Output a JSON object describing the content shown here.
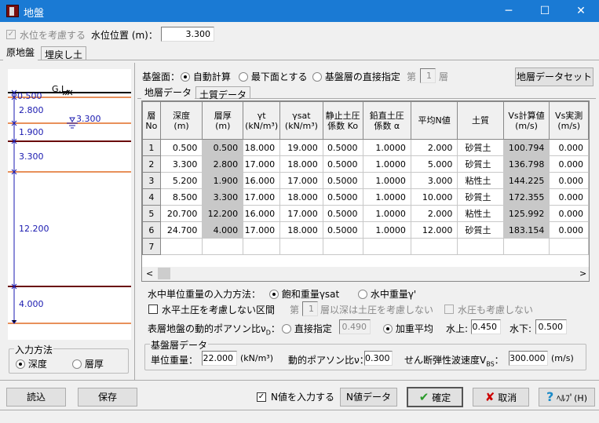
{
  "window": {
    "title": "地盤",
    "minimize": "─",
    "maximize": "☐",
    "close": "✕"
  },
  "water": {
    "consider_label": "水位を考慮する",
    "consider_checked": true,
    "level_label": "水位位置 (m)：",
    "level_value": "3.300"
  },
  "tabs": [
    "原地盤",
    "埋戻し土"
  ],
  "diagram": {
    "gl_label": "G.L.",
    "water_label": "3.300",
    "thickness_labels": [
      "0.500",
      "2.800",
      "1.900",
      "3.300",
      "12.200",
      "4.000"
    ],
    "colors": {
      "sand": "#e8905a",
      "clay": "#6a0c0c",
      "gl": "#000000",
      "dim": "#1a1ab0"
    }
  },
  "input_method": {
    "legend": "入力方法",
    "options": [
      "深度",
      "層厚"
    ],
    "selected": 0
  },
  "base": {
    "label": "基盤面：",
    "options": [
      "自動計算",
      "最下面とする",
      "基盤層の直接指定"
    ],
    "selected": 0,
    "layer_prefix": "第",
    "layer_value": "1",
    "layer_suffix": "層",
    "set_button": "地層データセット"
  },
  "inner_tabs": [
    "地層データ",
    "土質データ"
  ],
  "table": {
    "headers": [
      [
        "層",
        "No"
      ],
      [
        "深度",
        "(m)"
      ],
      [
        "層厚",
        "(m)"
      ],
      [
        "γt",
        "(kN/m³)"
      ],
      [
        "γsat",
        "(kN/m³)"
      ],
      [
        "静止土圧",
        "係数 Ko"
      ],
      [
        "鉛直土圧",
        "係数 α"
      ],
      [
        "平均N値",
        ""
      ],
      [
        "土質",
        ""
      ],
      [
        "Vs計算値",
        "(m/s)"
      ],
      [
        "Vs実測",
        "(m/s)"
      ]
    ],
    "rows": [
      [
        "1",
        "0.500",
        "0.500",
        "18.000",
        "19.000",
        "0.5000",
        "1.0000",
        "2.000",
        "砂質土",
        "100.794",
        "0.000"
      ],
      [
        "2",
        "3.300",
        "2.800",
        "17.000",
        "18.000",
        "0.5000",
        "1.0000",
        "5.000",
        "砂質土",
        "136.798",
        "0.000"
      ],
      [
        "3",
        "5.200",
        "1.900",
        "16.000",
        "17.000",
        "0.5000",
        "1.0000",
        "3.000",
        "粘性土",
        "144.225",
        "0.000"
      ],
      [
        "4",
        "8.500",
        "3.300",
        "17.000",
        "18.000",
        "0.5000",
        "1.0000",
        "10.000",
        "砂質土",
        "172.355",
        "0.000"
      ],
      [
        "5",
        "20.700",
        "12.200",
        "16.000",
        "17.000",
        "0.5000",
        "1.0000",
        "2.000",
        "粘性土",
        "125.992",
        "0.000"
      ],
      [
        "6",
        "24.700",
        "4.000",
        "17.000",
        "18.000",
        "0.5000",
        "1.0000",
        "12.000",
        "砂質土",
        "183.154",
        "0.000"
      ],
      [
        "7",
        "",
        "",
        "",
        "",
        "",
        "",
        "",
        "",
        "",
        ""
      ]
    ]
  },
  "submerged": {
    "label": "水中単位重量の入力方法：",
    "options": [
      "飽和重量γsat",
      "水中重量γ'"
    ],
    "selected": 0
  },
  "horiz": {
    "label": "水平土圧を考慮しない区間",
    "checked": false,
    "prefix": "第",
    "value": "1",
    "suffix": "層以深は土圧を考慮しない",
    "water_label": "水圧も考慮しない"
  },
  "poisson": {
    "label": "表層地盤の動的ポアソン比ν",
    "sub": "D",
    "colon": "：",
    "direct_label": "直接指定",
    "direct_value": "0.490",
    "avg_label": "加重平均",
    "selected": 1,
    "above_label": "水上:",
    "above_value": "0.450",
    "below_label": "水下:",
    "below_value": "0.500"
  },
  "base_layer": {
    "legend": "基盤層データ",
    "unit_weight_label": "単位重量：",
    "unit_weight": "22.000",
    "unit_weight_unit": "(kN/m³)",
    "poisson_label": "動的ポアソン比ν：",
    "poisson": "0.300",
    "vs_label": "せん断弾性波速度V",
    "vs_sub": "BS",
    "vs_colon": "：",
    "vs": "300.000",
    "vs_unit": "(m/s)"
  },
  "footer": {
    "load": "読込",
    "save": "保存",
    "n_input_label": "N値を入力する",
    "n_input_checked": true,
    "n_data": "N値データ",
    "ok": "確定",
    "cancel": "取消",
    "help": "ﾍﾙﾌﾟ(H)"
  }
}
